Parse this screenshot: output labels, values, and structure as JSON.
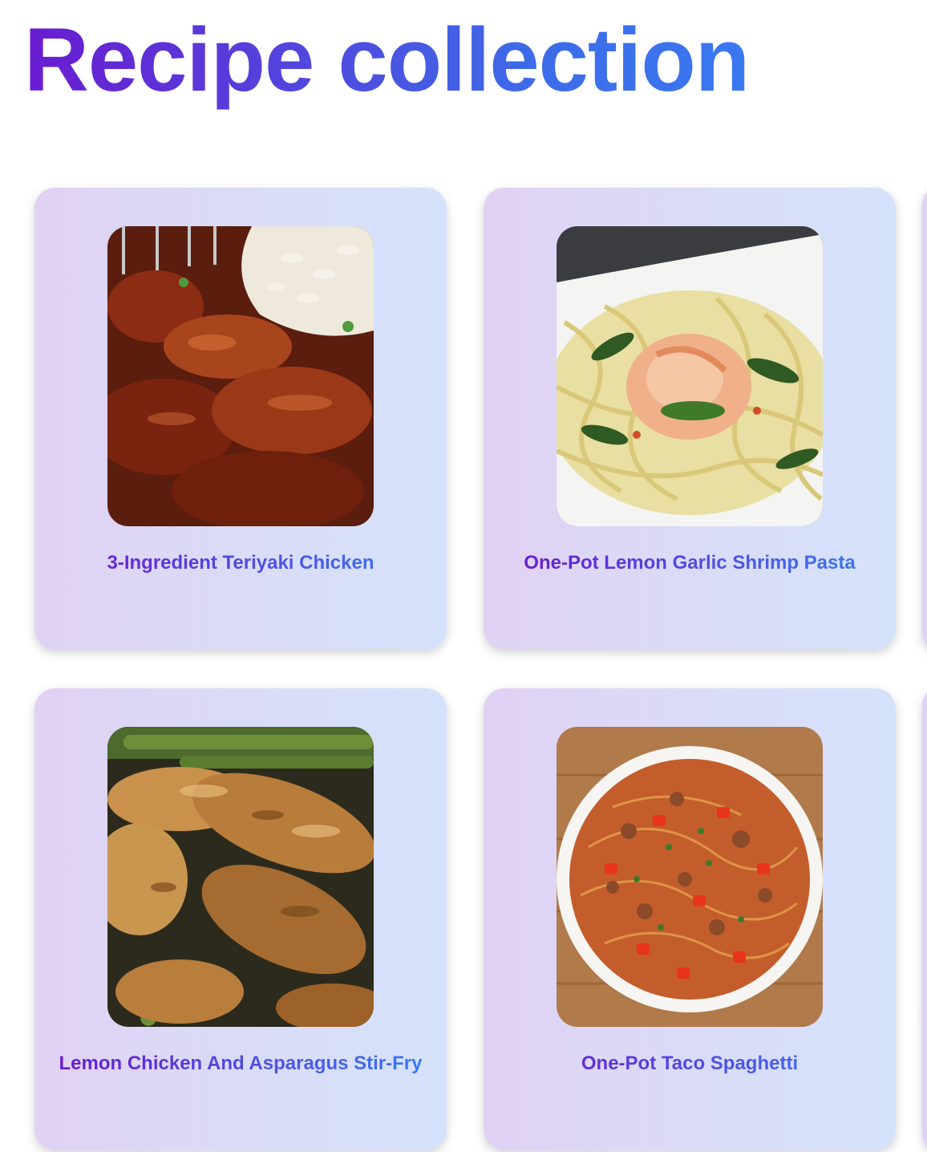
{
  "page": {
    "title": "Recipe collection"
  },
  "recipes": [
    {
      "title": "3-Ingredient Teriyaki Chicken",
      "image": "teriyaki-chicken-photo"
    },
    {
      "title": "One-Pot Lemon Garlic Shrimp Pasta",
      "image": "shrimp-pasta-photo"
    },
    {
      "title": "Lemon Chicken And Asparagus Stir-Fry",
      "image": "chicken-asparagus-photo"
    },
    {
      "title": "One-Pot Taco Spaghetti",
      "image": "taco-spaghetti-photo"
    }
  ],
  "colors": {
    "title_gradient_start": "#6a1bd0",
    "title_gradient_end": "#3a78f0",
    "card_gradient_start": "#e1d1f4",
    "card_gradient_end": "#d5e2fb"
  }
}
